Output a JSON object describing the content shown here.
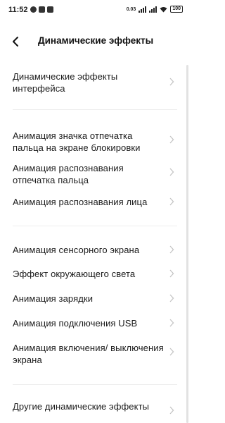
{
  "status_bar": {
    "time": "11:52",
    "network_speed": "0.03",
    "battery": "100"
  },
  "header": {
    "title": "Динамические эффекты"
  },
  "items": [
    {
      "label": "Динамические эффекты интерфейса"
    },
    {
      "label": "Анимация значка отпечатка пальца на экране блокировки"
    },
    {
      "label": "Анимация распознавания отпечатка пальца"
    },
    {
      "label": "Анимация распознавания лица"
    },
    {
      "label": "Анимация сенсорного экрана"
    },
    {
      "label": "Эффект окружающего света"
    },
    {
      "label": "Анимация зарядки"
    },
    {
      "label": "Анимация подключения USB"
    },
    {
      "label": "Анимация включения/ выключения экрана"
    },
    {
      "label": "Другие динамические эффекты"
    }
  ],
  "icons": {
    "back": "back-arrow-icon",
    "chevron": "chevron-right-icon"
  },
  "colors": {
    "background": "#ffffff",
    "text": "#1b1b1b",
    "chevron": "#c4c4c4"
  }
}
